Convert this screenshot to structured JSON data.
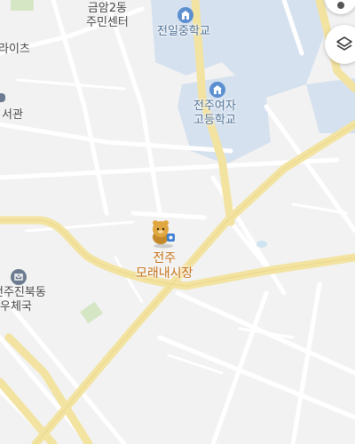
{
  "map": {
    "labels": {
      "geumam_center_line1": "금암2동",
      "geumam_center_line2": "주민센터",
      "school_jeonil": "전일중학교",
      "school_girls_line1": "전주여자",
      "school_girls_line2": "고등학교",
      "market_line1": "전주",
      "market_line2": "모래내시장",
      "post_line1": "전주진북동",
      "post_line2": "우체국",
      "partial_left_1": "라이츠",
      "partial_left_2": "서관"
    },
    "icons": {
      "school": "school-icon",
      "post_office": "post-office-icon",
      "character": "character-marker-icon",
      "layers": "layers-icon"
    },
    "colors": {
      "background": "#f2f2f2",
      "major_road": "#f3e3a1",
      "minor_road": "#ffffff",
      "school_area": "#d6e1ef",
      "park": "#d4e6c3",
      "water": "#cfe3f1"
    }
  }
}
